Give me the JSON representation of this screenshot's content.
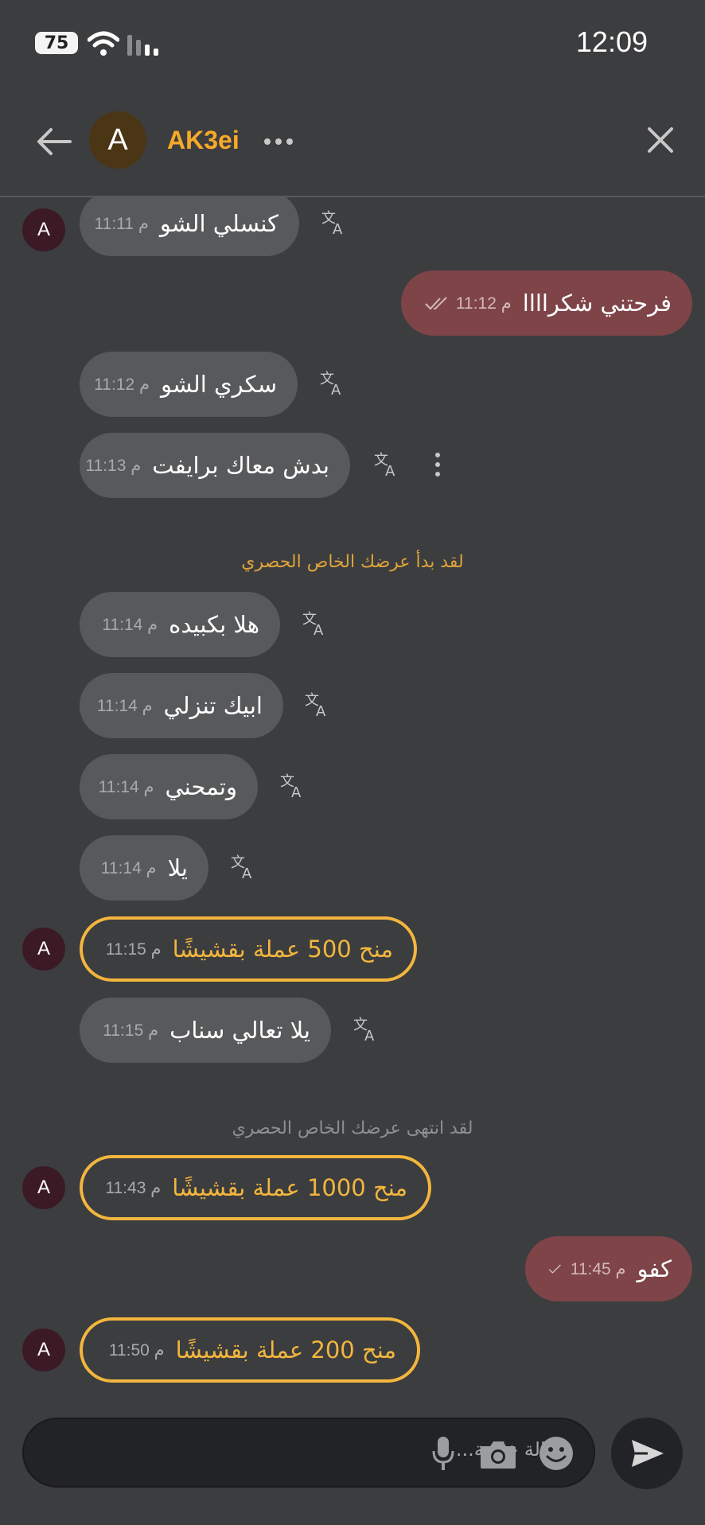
{
  "status_bar": {
    "battery": "75",
    "time": "12:09"
  },
  "header": {
    "avatar_letter": "A",
    "name": "AK3ei"
  },
  "messages": [
    {
      "text": "كنسلي الشو",
      "time": "م 11:11"
    },
    {
      "text": "فرحتني شكراااا",
      "time": "م 11:12"
    },
    {
      "text": "سكري الشو",
      "time": "م 11:12"
    },
    {
      "text": "بدش معاك برايفت",
      "time": "م 11:13"
    },
    {
      "text": "هلا بكبيده",
      "time": "م 11:14"
    },
    {
      "text": "ابيك تنزلي",
      "time": "م 11:14"
    },
    {
      "text": "وتمحني",
      "time": "م 11:14"
    },
    {
      "text": "يلا",
      "time": "م 11:14"
    },
    {
      "text": "منح 500 عملة بقشيشًا",
      "time": "م 11:15"
    },
    {
      "text": "يلا تعالي سناب",
      "time": "م 11:15"
    },
    {
      "text": "منح 1000 عملة بقشيشًا",
      "time": "م 11:43"
    },
    {
      "text": "كفو",
      "time": "م 11:45"
    },
    {
      "text": "منح 200 عملة بقشيشًا",
      "time": "م 11:50"
    }
  ],
  "system_messages": {
    "private_started": "لقد بدأ عرضك الخاص الحصري",
    "private_ended": "لقد انتهى عرضك الخاص الحصري"
  },
  "avatar_letter": "A",
  "composer": {
    "placeholder": "رسالة خاصة..."
  },
  "colors": {
    "accent": "#f7a928",
    "gift_border": "#f3b63d",
    "outgoing_bubble": "#7e4448",
    "incoming_bubble": "#58595b",
    "background": "#3c3d3f"
  },
  "icons": [
    "back-arrow-icon",
    "more-icon",
    "close-icon",
    "translate-icon",
    "kebab-menu-icon",
    "read-check-icon",
    "microphone-icon",
    "camera-icon",
    "emoji-icon",
    "send-icon"
  ]
}
